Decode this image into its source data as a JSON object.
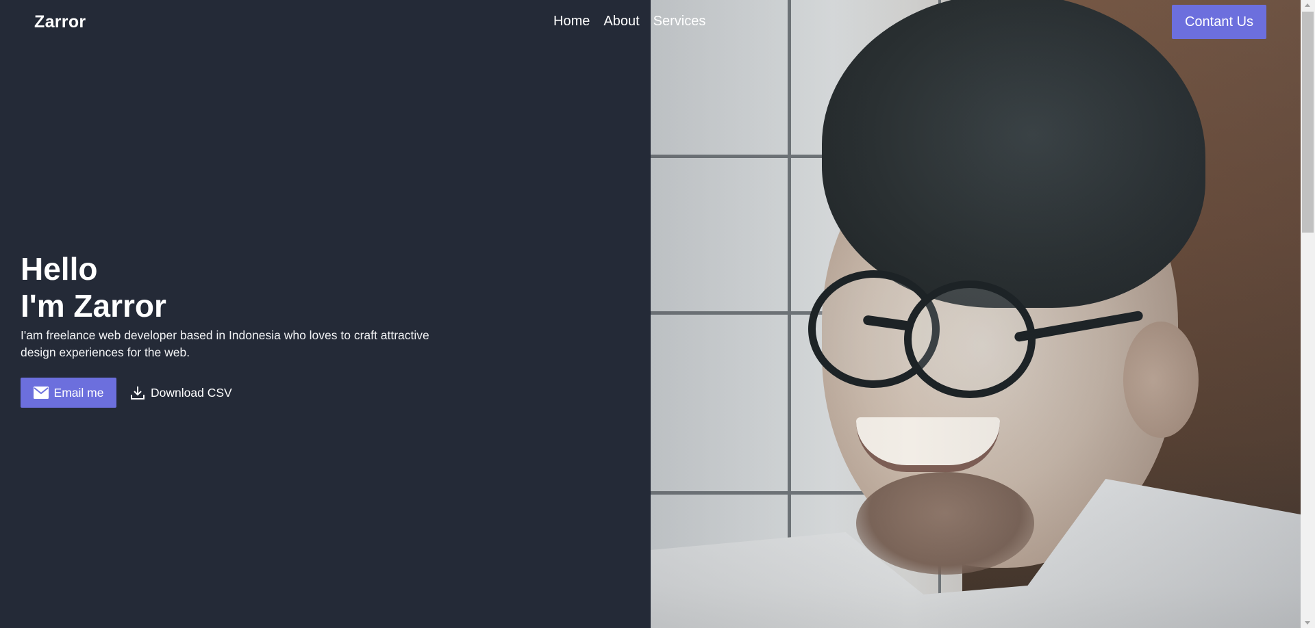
{
  "header": {
    "logo": "Zarror",
    "nav": [
      {
        "label": "Home"
      },
      {
        "label": "About"
      },
      {
        "label": "Services"
      }
    ],
    "contact_label": "Contant Us"
  },
  "hero": {
    "title_line1": "Hello",
    "title_line2": "I'm Zarror",
    "description": "I'am freelance web developer based in Indonesia who loves to craft attractive design experiences for the web.",
    "email_label": "Email me",
    "email_icon": "mail-icon",
    "download_label": "Download CSV",
    "download_icon": "download-icon"
  },
  "colors": {
    "background": "#242a37",
    "accent": "#6c6fdd",
    "text": "#ffffff"
  }
}
